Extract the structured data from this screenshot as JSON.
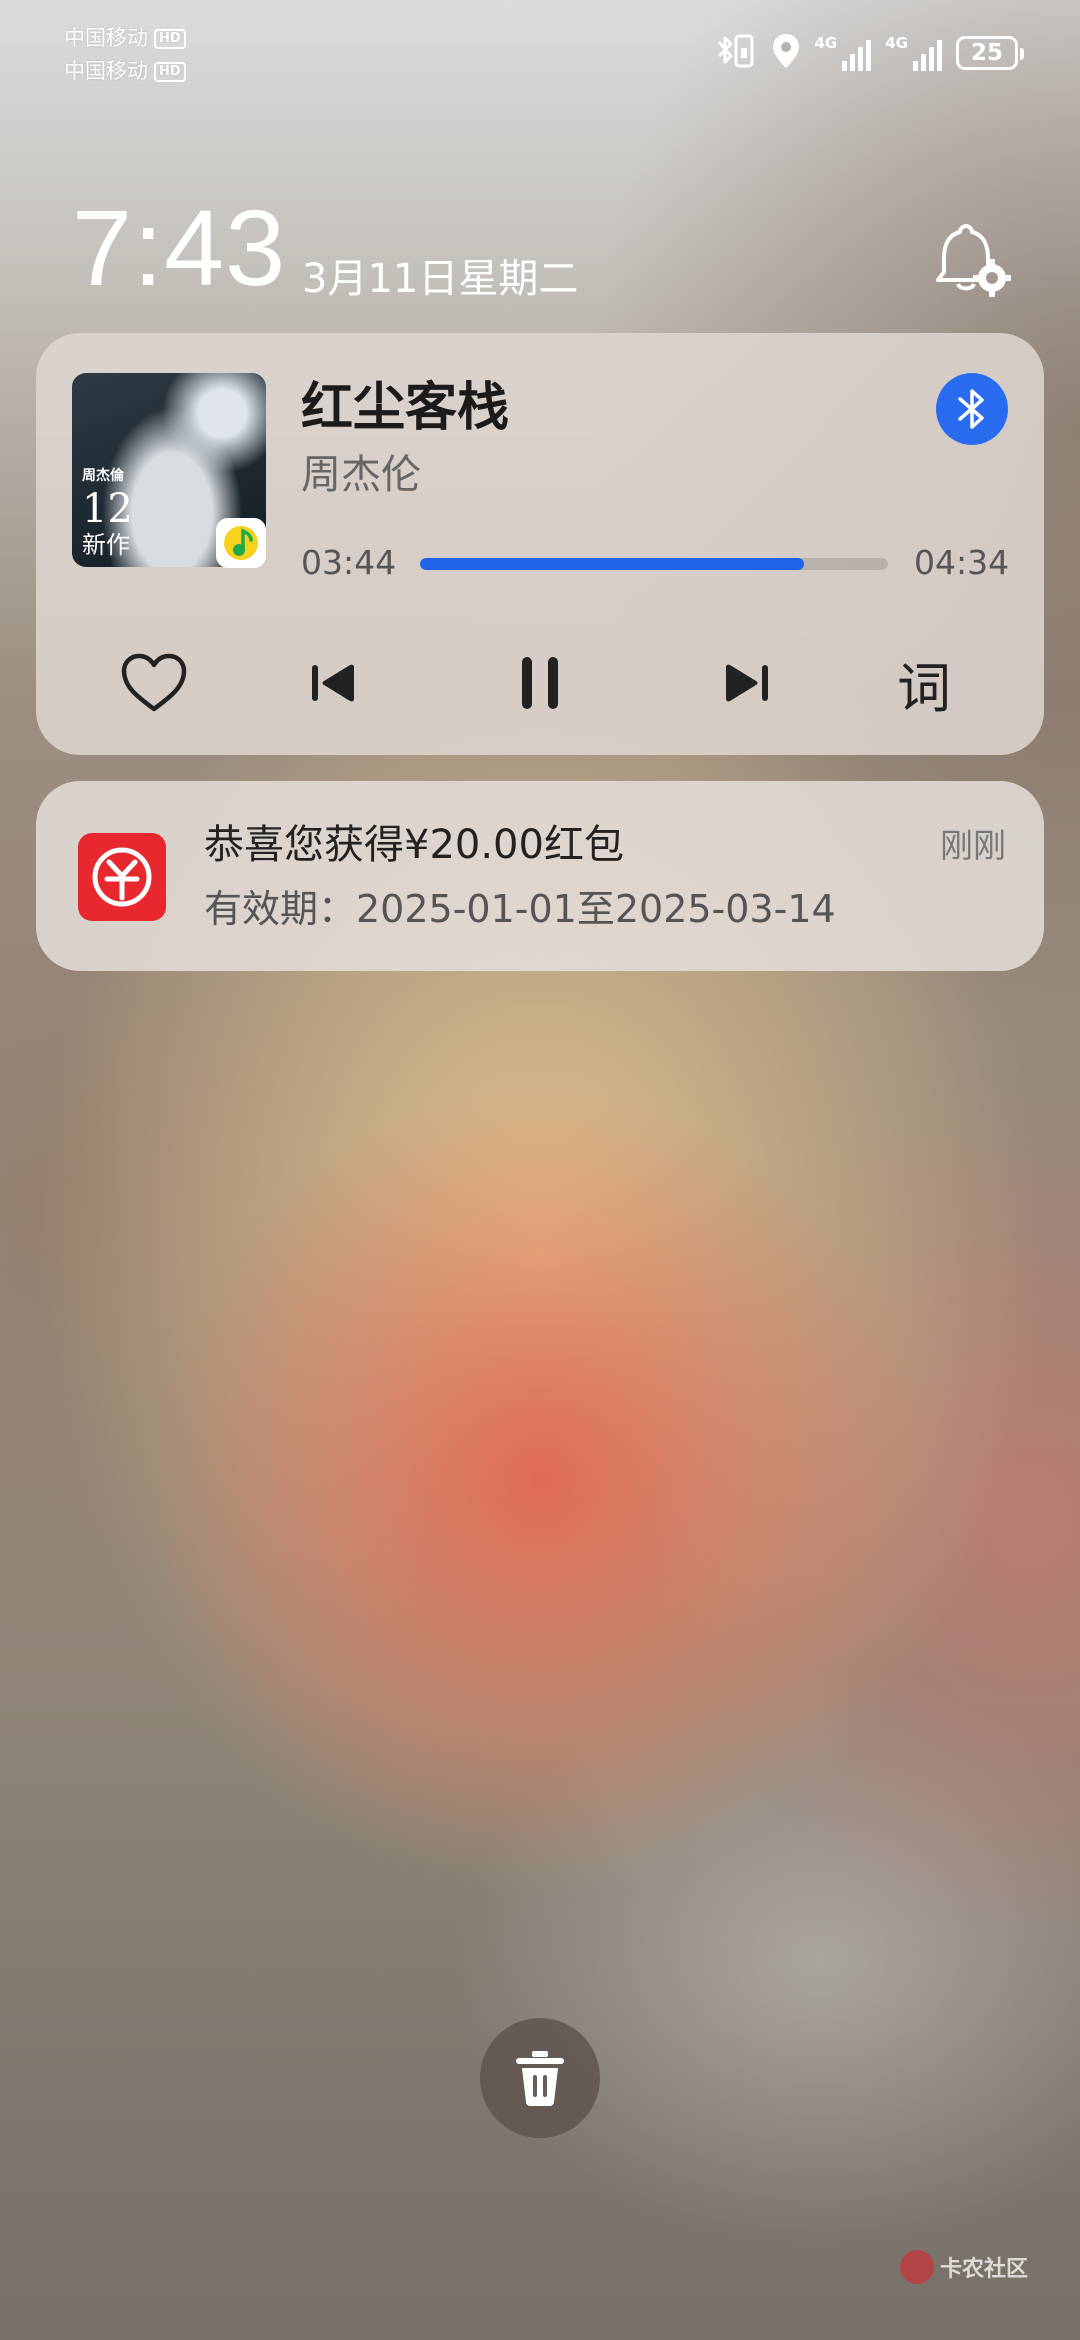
{
  "status_bar": {
    "carriers": [
      {
        "name": "中国移动",
        "badge": "HD"
      },
      {
        "name": "中国移动",
        "badge": "HD"
      }
    ],
    "icons": [
      "bluetooth-phone-icon",
      "location-icon",
      "signal-4g-icon",
      "signal-4g-icon",
      "battery-icon"
    ],
    "signal_labels": [
      "4G",
      "4G"
    ],
    "battery_level": "25"
  },
  "lockscreen": {
    "time": "7:43",
    "date": "3月11日星期二"
  },
  "media_card": {
    "song_title": "红尘客栈",
    "artist": "周杰伦",
    "album_art": {
      "line1": "周杰倫",
      "line2": "12",
      "line3": "新作"
    },
    "elapsed": "03:44",
    "total": "04:34",
    "progress_fraction": 0.82,
    "lyrics_label": "词",
    "accent_color": "#1f63e8"
  },
  "notification": {
    "title": "恭喜您获得¥20.00红包",
    "body": "有效期：2025-01-01至2025-03-14",
    "time": "刚刚",
    "icon_color": "#e8282f"
  },
  "watermark": {
    "text": "卡农社区"
  }
}
